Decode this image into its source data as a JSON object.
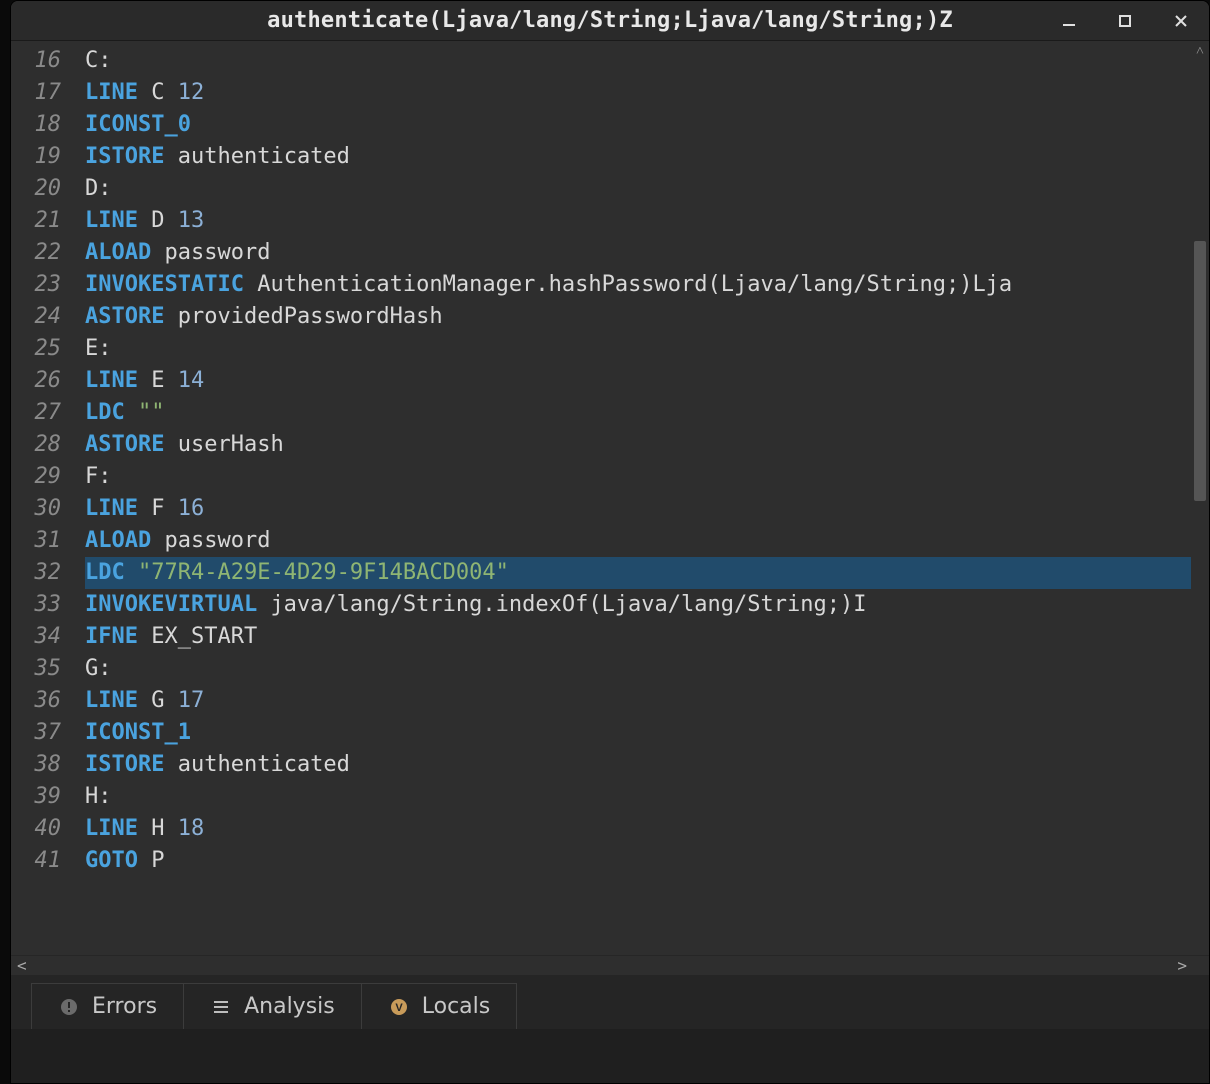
{
  "window": {
    "title": "authenticate(Ljava/lang/String;Ljava/lang/String;)Z"
  },
  "editor": {
    "first_line_number": 16,
    "selected_line_number": 32,
    "lines": [
      {
        "tokens": [
          {
            "t": "C:",
            "c": "label"
          }
        ]
      },
      {
        "tokens": [
          {
            "t": "LINE",
            "c": "kw"
          },
          {
            "t": " ",
            "c": "plain"
          },
          {
            "t": "C",
            "c": "plain"
          },
          {
            "t": " ",
            "c": "plain"
          },
          {
            "t": "12",
            "c": "lit"
          }
        ]
      },
      {
        "tokens": [
          {
            "t": "ICONST_0",
            "c": "kw"
          }
        ]
      },
      {
        "tokens": [
          {
            "t": "ISTORE",
            "c": "kw"
          },
          {
            "t": " ",
            "c": "plain"
          },
          {
            "t": "authenticated",
            "c": "plain"
          }
        ]
      },
      {
        "tokens": [
          {
            "t": "D:",
            "c": "label"
          }
        ]
      },
      {
        "tokens": [
          {
            "t": "LINE",
            "c": "kw"
          },
          {
            "t": " ",
            "c": "plain"
          },
          {
            "t": "D",
            "c": "plain"
          },
          {
            "t": " ",
            "c": "plain"
          },
          {
            "t": "13",
            "c": "lit"
          }
        ]
      },
      {
        "tokens": [
          {
            "t": "ALOAD",
            "c": "kw"
          },
          {
            "t": " ",
            "c": "plain"
          },
          {
            "t": "password",
            "c": "plain"
          }
        ]
      },
      {
        "tokens": [
          {
            "t": "INVOKESTATIC",
            "c": "kw"
          },
          {
            "t": " ",
            "c": "plain"
          },
          {
            "t": "AuthenticationManager.hashPassword(Ljava/lang/String;)Lja",
            "c": "plain"
          }
        ]
      },
      {
        "tokens": [
          {
            "t": "ASTORE",
            "c": "kw"
          },
          {
            "t": " ",
            "c": "plain"
          },
          {
            "t": "providedPasswordHash",
            "c": "plain"
          }
        ]
      },
      {
        "tokens": [
          {
            "t": "E:",
            "c": "label"
          }
        ]
      },
      {
        "tokens": [
          {
            "t": "LINE",
            "c": "kw"
          },
          {
            "t": " ",
            "c": "plain"
          },
          {
            "t": "E",
            "c": "plain"
          },
          {
            "t": " ",
            "c": "plain"
          },
          {
            "t": "14",
            "c": "lit"
          }
        ]
      },
      {
        "tokens": [
          {
            "t": "LDC",
            "c": "kw"
          },
          {
            "t": " ",
            "c": "plain"
          },
          {
            "t": "\"\"",
            "c": "str"
          }
        ]
      },
      {
        "tokens": [
          {
            "t": "ASTORE",
            "c": "kw"
          },
          {
            "t": " ",
            "c": "plain"
          },
          {
            "t": "userHash",
            "c": "plain"
          }
        ]
      },
      {
        "tokens": [
          {
            "t": "F:",
            "c": "label"
          }
        ]
      },
      {
        "tokens": [
          {
            "t": "LINE",
            "c": "kw"
          },
          {
            "t": " ",
            "c": "plain"
          },
          {
            "t": "F",
            "c": "plain"
          },
          {
            "t": " ",
            "c": "plain"
          },
          {
            "t": "16",
            "c": "lit"
          }
        ]
      },
      {
        "tokens": [
          {
            "t": "ALOAD",
            "c": "kw"
          },
          {
            "t": " ",
            "c": "plain"
          },
          {
            "t": "password",
            "c": "plain"
          }
        ]
      },
      {
        "tokens": [
          {
            "t": "LDC",
            "c": "kw"
          },
          {
            "t": " ",
            "c": "plain"
          },
          {
            "t": "\"77R4-A29E-4D29-9F14BACD004\"",
            "c": "str"
          }
        ]
      },
      {
        "tokens": [
          {
            "t": "INVOKEVIRTUAL",
            "c": "kw"
          },
          {
            "t": " ",
            "c": "plain"
          },
          {
            "t": "java/lang/String.indexOf(Ljava/lang/String;)I",
            "c": "plain"
          }
        ]
      },
      {
        "tokens": [
          {
            "t": "IFNE",
            "c": "kw"
          },
          {
            "t": " ",
            "c": "plain"
          },
          {
            "t": "EX_START",
            "c": "plain"
          }
        ]
      },
      {
        "tokens": [
          {
            "t": "G:",
            "c": "label"
          }
        ]
      },
      {
        "tokens": [
          {
            "t": "LINE",
            "c": "kw"
          },
          {
            "t": " ",
            "c": "plain"
          },
          {
            "t": "G",
            "c": "plain"
          },
          {
            "t": " ",
            "c": "plain"
          },
          {
            "t": "17",
            "c": "lit"
          }
        ]
      },
      {
        "tokens": [
          {
            "t": "ICONST_1",
            "c": "kw"
          }
        ]
      },
      {
        "tokens": [
          {
            "t": "ISTORE",
            "c": "kw"
          },
          {
            "t": " ",
            "c": "plain"
          },
          {
            "t": "authenticated",
            "c": "plain"
          }
        ]
      },
      {
        "tokens": [
          {
            "t": "H:",
            "c": "label"
          }
        ]
      },
      {
        "tokens": [
          {
            "t": "LINE",
            "c": "kw"
          },
          {
            "t": " ",
            "c": "plain"
          },
          {
            "t": "H",
            "c": "plain"
          },
          {
            "t": " ",
            "c": "plain"
          },
          {
            "t": "18",
            "c": "lit"
          }
        ]
      },
      {
        "tokens": [
          {
            "t": "GOTO",
            "c": "kw"
          },
          {
            "t": " ",
            "c": "plain"
          },
          {
            "t": "P",
            "c": "plain"
          }
        ]
      }
    ]
  },
  "tabs": {
    "errors": "Errors",
    "analysis": "Analysis",
    "locals": "Locals"
  }
}
